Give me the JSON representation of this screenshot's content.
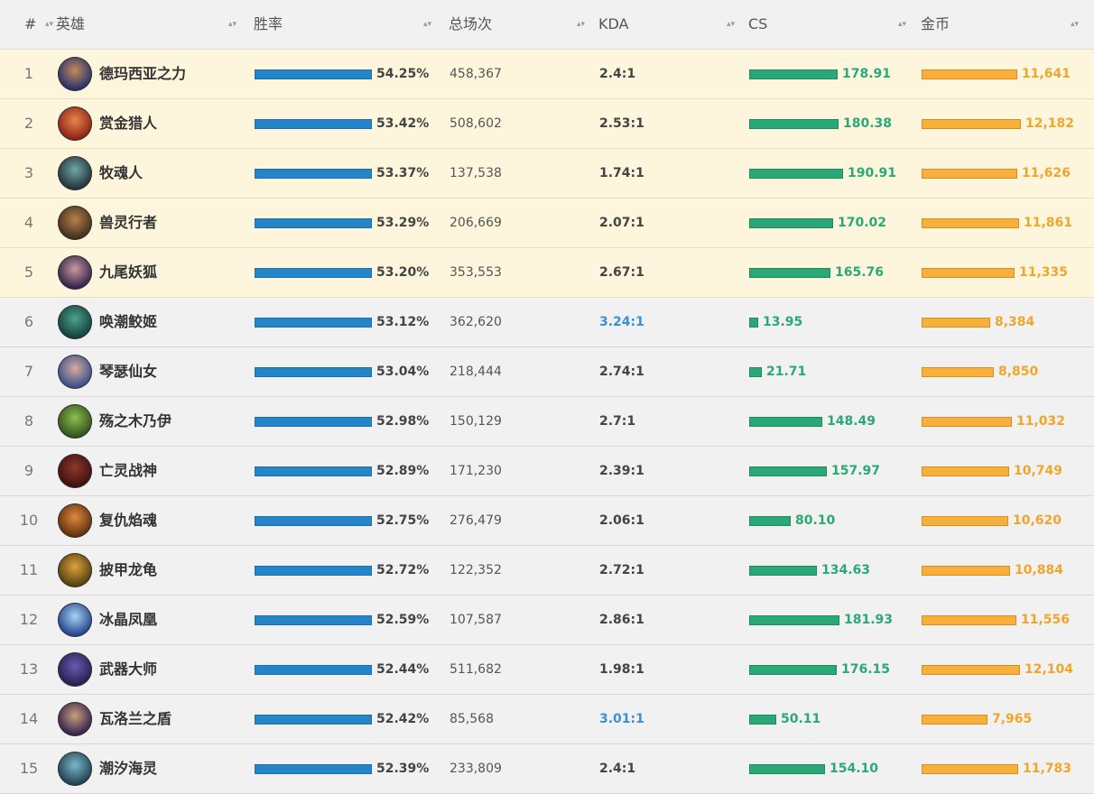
{
  "header": {
    "rank": "#",
    "hero": "英雄",
    "winrate": "胜率",
    "games": "总场次",
    "kda": "KDA",
    "cs": "CS",
    "gold": "金币"
  },
  "colors": {
    "winrate_bar": "#2585c9",
    "cs_bar": "#2aa877",
    "gold_bar": "#f7b03c",
    "highlight_row": "#fdf6dc",
    "kda_highlight": "#3a8fd6"
  },
  "rows": [
    {
      "rank": "1",
      "hero": "德玛西亚之力",
      "winrate": "54.25%",
      "win_fill": 1.0,
      "games": "458,367",
      "kda": "2.4:1",
      "kda_high": false,
      "cs": "178.91",
      "cs_fill": 0.94,
      "gold": "11,641",
      "gold_fill": 0.96,
      "highlight": true,
      "avatar": [
        "#1b2c6b",
        "#c58a5a"
      ]
    },
    {
      "rank": "2",
      "hero": "赏金猎人",
      "winrate": "53.42%",
      "win_fill": 1.0,
      "games": "508,602",
      "kda": "2.53:1",
      "kda_high": false,
      "cs": "180.38",
      "cs_fill": 0.95,
      "gold": "12,182",
      "gold_fill": 1.0,
      "highlight": true,
      "avatar": [
        "#8a1a12",
        "#e4874a"
      ]
    },
    {
      "rank": "3",
      "hero": "牧魂人",
      "winrate": "53.37%",
      "win_fill": 1.0,
      "games": "137,538",
      "kda": "1.74:1",
      "kda_high": false,
      "cs": "190.91",
      "cs_fill": 1.0,
      "gold": "11,626",
      "gold_fill": 0.96,
      "highlight": true,
      "avatar": [
        "#1d2b33",
        "#6fa7a8"
      ]
    },
    {
      "rank": "4",
      "hero": "兽灵行者",
      "winrate": "53.29%",
      "win_fill": 1.0,
      "games": "206,669",
      "kda": "2.07:1",
      "kda_high": false,
      "cs": "170.02",
      "cs_fill": 0.89,
      "gold": "11,861",
      "gold_fill": 0.98,
      "highlight": true,
      "avatar": [
        "#3a2a1c",
        "#b8804c"
      ]
    },
    {
      "rank": "5",
      "hero": "九尾妖狐",
      "winrate": "53.20%",
      "win_fill": 1.0,
      "games": "353,553",
      "kda": "2.67:1",
      "kda_high": false,
      "cs": "165.76",
      "cs_fill": 0.87,
      "gold": "11,335",
      "gold_fill": 0.94,
      "highlight": true,
      "avatar": [
        "#2b1b45",
        "#c79a9c"
      ]
    },
    {
      "rank": "6",
      "hero": "唤潮鲛姬",
      "winrate": "53.12%",
      "win_fill": 1.0,
      "games": "362,620",
      "kda": "3.24:1",
      "kda_high": true,
      "cs": "13.95",
      "cs_fill": 0.09,
      "gold": "8,384",
      "gold_fill": 0.69,
      "highlight": false,
      "avatar": [
        "#0e3b3a",
        "#4fa28a"
      ]
    },
    {
      "rank": "7",
      "hero": "琴瑟仙女",
      "winrate": "53.04%",
      "win_fill": 1.0,
      "games": "218,444",
      "kda": "2.74:1",
      "kda_high": false,
      "cs": "21.71",
      "cs_fill": 0.13,
      "gold": "8,850",
      "gold_fill": 0.73,
      "highlight": false,
      "avatar": [
        "#2d4a8a",
        "#d9a9a0"
      ]
    },
    {
      "rank": "8",
      "hero": "殇之木乃伊",
      "winrate": "52.98%",
      "win_fill": 1.0,
      "games": "150,129",
      "kda": "2.7:1",
      "kda_high": false,
      "cs": "148.49",
      "cs_fill": 0.78,
      "gold": "11,032",
      "gold_fill": 0.91,
      "highlight": false,
      "avatar": [
        "#2e4a1c",
        "#8cbf4e"
      ]
    },
    {
      "rank": "9",
      "hero": "亡灵战神",
      "winrate": "52.89%",
      "win_fill": 1.0,
      "games": "171,230",
      "kda": "2.39:1",
      "kda_high": false,
      "cs": "157.97",
      "cs_fill": 0.83,
      "gold": "10,749",
      "gold_fill": 0.88,
      "highlight": false,
      "avatar": [
        "#3a0e0e",
        "#8c3a2a"
      ]
    },
    {
      "rank": "10",
      "hero": "复仇焰魂",
      "winrate": "52.75%",
      "win_fill": 1.0,
      "games": "276,479",
      "kda": "2.06:1",
      "kda_high": false,
      "cs": "80.10",
      "cs_fill": 0.44,
      "gold": "10,620",
      "gold_fill": 0.87,
      "highlight": false,
      "avatar": [
        "#5a2a0e",
        "#e08a3a"
      ]
    },
    {
      "rank": "11",
      "hero": "披甲龙龟",
      "winrate": "52.72%",
      "win_fill": 1.0,
      "games": "122,352",
      "kda": "2.72:1",
      "kda_high": false,
      "cs": "134.63",
      "cs_fill": 0.72,
      "gold": "10,884",
      "gold_fill": 0.89,
      "highlight": false,
      "avatar": [
        "#4a3a0e",
        "#e0a23a"
      ]
    },
    {
      "rank": "12",
      "hero": "冰晶凤凰",
      "winrate": "52.59%",
      "win_fill": 1.0,
      "games": "107,587",
      "kda": "2.86:1",
      "kda_high": false,
      "cs": "181.93",
      "cs_fill": 0.96,
      "gold": "11,556",
      "gold_fill": 0.95,
      "highlight": false,
      "avatar": [
        "#1a3a8a",
        "#a8d4f0"
      ]
    },
    {
      "rank": "13",
      "hero": "武器大师",
      "winrate": "52.44%",
      "win_fill": 1.0,
      "games": "511,682",
      "kda": "1.98:1",
      "kda_high": false,
      "cs": "176.15",
      "cs_fill": 0.93,
      "gold": "12,104",
      "gold_fill": 0.99,
      "highlight": false,
      "avatar": [
        "#241a4a",
        "#6a5ab0"
      ]
    },
    {
      "rank": "14",
      "hero": "瓦洛兰之盾",
      "winrate": "52.42%",
      "win_fill": 1.0,
      "games": "85,568",
      "kda": "3.01:1",
      "kda_high": true,
      "cs": "50.11",
      "cs_fill": 0.29,
      "gold": "7,965",
      "gold_fill": 0.66,
      "highlight": false,
      "avatar": [
        "#2a1a4a",
        "#c8a07a"
      ]
    },
    {
      "rank": "15",
      "hero": "潮汐海灵",
      "winrate": "52.39%",
      "win_fill": 1.0,
      "games": "233,809",
      "kda": "2.4:1",
      "kda_high": false,
      "cs": "154.10",
      "cs_fill": 0.81,
      "gold": "11,783",
      "gold_fill": 0.97,
      "highlight": false,
      "avatar": [
        "#1a3a4a",
        "#7ab8c8"
      ]
    }
  ]
}
